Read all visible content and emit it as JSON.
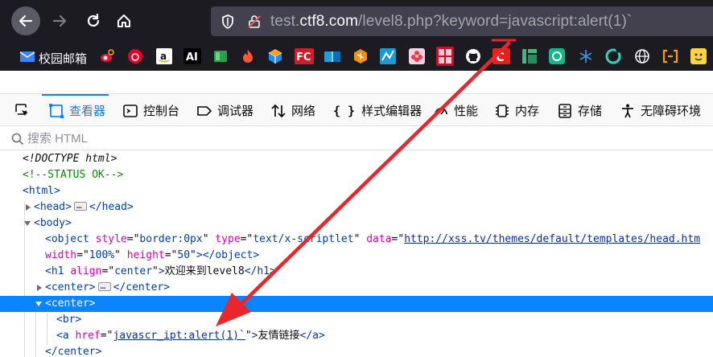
{
  "browser": {
    "url_prefix": "test.",
    "url_domain": "ctf8.com",
    "url_path": "/level8.php?keyword=javascript:alert(1)`",
    "bookmarks": [
      {
        "label": "校园邮箱",
        "icon": "mail-icon"
      },
      {
        "label": "",
        "icon": "weibo-icon"
      },
      {
        "label": "",
        "icon": "netease-music-icon"
      },
      {
        "label": "",
        "icon": "amazon-icon"
      },
      {
        "label": "AI",
        "icon": "ai-icon"
      },
      {
        "label": "",
        "icon": "green-book-icon"
      },
      {
        "label": "",
        "icon": "fire-icon"
      },
      {
        "label": "",
        "icon": "cube-icon"
      },
      {
        "label": "FC",
        "icon": "fc-icon"
      },
      {
        "label": "",
        "icon": "blue-book-icon"
      },
      {
        "label": "",
        "icon": "orange-hex-icon"
      },
      {
        "label": "",
        "icon": "blue-chart-icon"
      },
      {
        "label": "",
        "icon": "flower-icon"
      },
      {
        "label": "",
        "icon": "red-seal-icon"
      },
      {
        "label": "",
        "icon": "github-icon"
      },
      {
        "label": "",
        "icon": "csdn-icon"
      },
      {
        "label": "",
        "icon": "green-bars-icon"
      },
      {
        "label": "",
        "icon": "green-badge-icon"
      },
      {
        "label": "",
        "icon": "snowflake-icon"
      },
      {
        "label": "",
        "icon": "c-ring-icon"
      },
      {
        "label": "",
        "icon": "globe-icon"
      },
      {
        "label": "",
        "icon": "bracket-icon"
      },
      {
        "label": "",
        "icon": "face-icon"
      }
    ]
  },
  "devtools": {
    "tabs": [
      {
        "label": "查看器",
        "icon": "inspector-icon",
        "active": true
      },
      {
        "label": "控制台",
        "icon": "console-icon"
      },
      {
        "label": "调试器",
        "icon": "debugger-icon"
      },
      {
        "label": "网络",
        "icon": "network-icon"
      },
      {
        "label": "样式编辑器",
        "icon": "style-editor-icon"
      },
      {
        "label": "性能",
        "icon": "performance-icon"
      },
      {
        "label": "内存",
        "icon": "memory-icon"
      },
      {
        "label": "存储",
        "icon": "storage-icon"
      },
      {
        "label": "无障碍环境",
        "icon": "accessibility-icon"
      }
    ],
    "search_placeholder": "搜索 HTML",
    "tree": {
      "doctype": "<!DOCTYPE html>",
      "comment": "<!--STATUS OK-->",
      "html": "html",
      "head": "head",
      "body": "body",
      "object_tag": "object",
      "object_style_attr": "style",
      "object_style_val": "border:0px",
      "object_type_attr": "type",
      "object_type_val": "text/x-scriptlet",
      "object_data_attr": "data",
      "object_data_val": "http://xss.tv/themes/default/templates/head.htm",
      "object_width_attr": "width",
      "object_width_val": "100%",
      "object_height_attr": "height",
      "object_height_val": "50",
      "h1_tag": "h1",
      "h1_align_attr": "align",
      "h1_align_val": "center",
      "h1_text": "欢迎来到level8",
      "center": "center",
      "br": "br",
      "a_tag": "a",
      "a_href_attr": "href",
      "a_href_val": "javascr_ipt:alert(1)`",
      "a_text": "友情链接"
    }
  },
  "colors": {
    "accent": "#0a84ff",
    "annotation_arrow": "#e8262b"
  }
}
